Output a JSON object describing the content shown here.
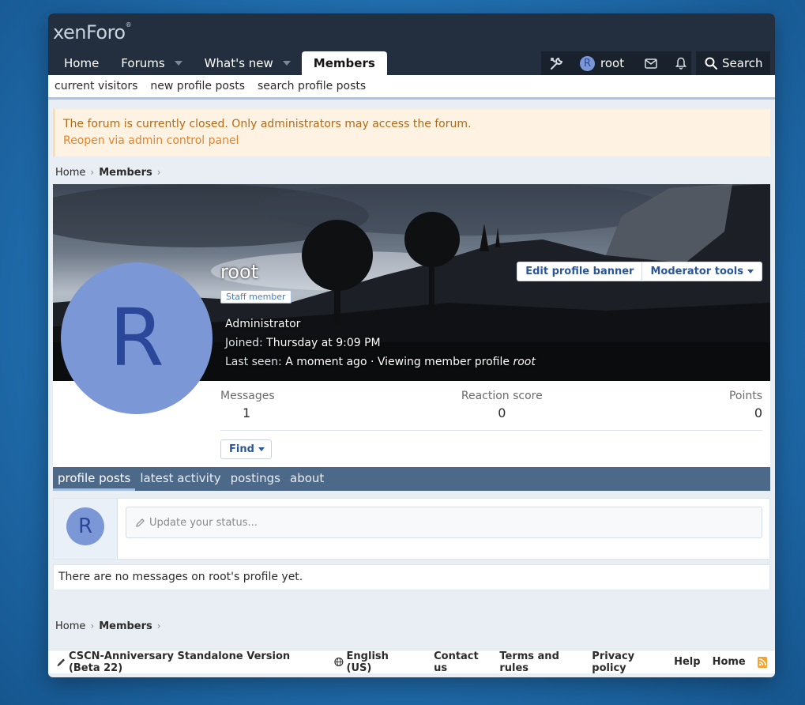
{
  "logo": {
    "text": "xenForo",
    "reg": "®"
  },
  "nav": {
    "tabs": [
      {
        "label": "Home"
      },
      {
        "label": "Forums"
      },
      {
        "label": "What's new"
      },
      {
        "label": "Members"
      }
    ]
  },
  "user": {
    "initial": "R",
    "name": "root"
  },
  "search": {
    "label": "Search"
  },
  "subnav": {
    "items": [
      "current visitors",
      "new profile posts",
      "search profile posts"
    ]
  },
  "notice": {
    "message": "The forum is currently closed. Only administrators may access the forum.",
    "link": "Reopen via admin control panel"
  },
  "breadcrumb": {
    "home": "Home",
    "members": "Members"
  },
  "profile": {
    "initial": "R",
    "username": "root",
    "badge": "Staff member",
    "title": "Administrator",
    "joined_label": "Joined:",
    "joined_value": "Thursday at 9:09 PM",
    "last_seen_label": "Last seen:",
    "last_seen_value": "A moment ago · Viewing member profile",
    "last_seen_user": "root",
    "edit_banner": "Edit profile banner",
    "moderator_tools": "Moderator tools",
    "stats": [
      {
        "label": "Messages",
        "value": "1"
      },
      {
        "label": "Reaction score",
        "value": "0"
      },
      {
        "label": "Points",
        "value": "0"
      }
    ],
    "find": "Find"
  },
  "profile_tabs": [
    "profile posts",
    "latest activity",
    "postings",
    "about"
  ],
  "status": {
    "initial": "R",
    "placeholder": "Update your status..."
  },
  "no_messages": "There are no messages on root's profile yet.",
  "footer": {
    "style": "CSCN-Anniversary Standalone Version (Beta 22)",
    "language": "English (US)",
    "links": [
      "Contact us",
      "Terms and rules",
      "Privacy policy",
      "Help",
      "Home"
    ]
  }
}
